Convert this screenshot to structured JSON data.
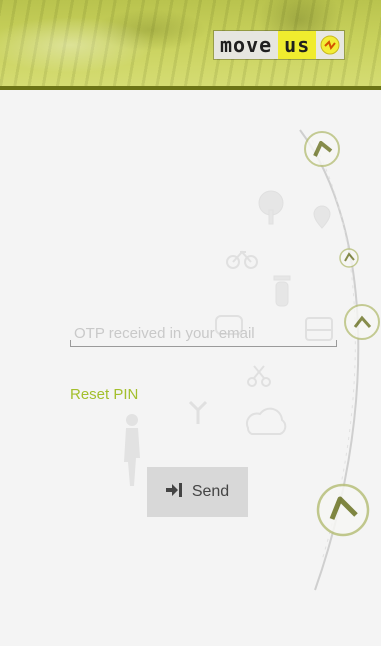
{
  "header": {
    "logo_move": "move",
    "logo_us": "us"
  },
  "form": {
    "otp_placeholder": "OTP received in your email",
    "otp_value": "",
    "reset_pin_label": "Reset PIN",
    "send_label": "Send",
    "send_icon": "sign-in-icon"
  },
  "colors": {
    "accent_green": "#a3bf2c",
    "header_green": "#c8d15c",
    "header_border": "#6c7416",
    "button_bg": "#d8d8d8"
  }
}
